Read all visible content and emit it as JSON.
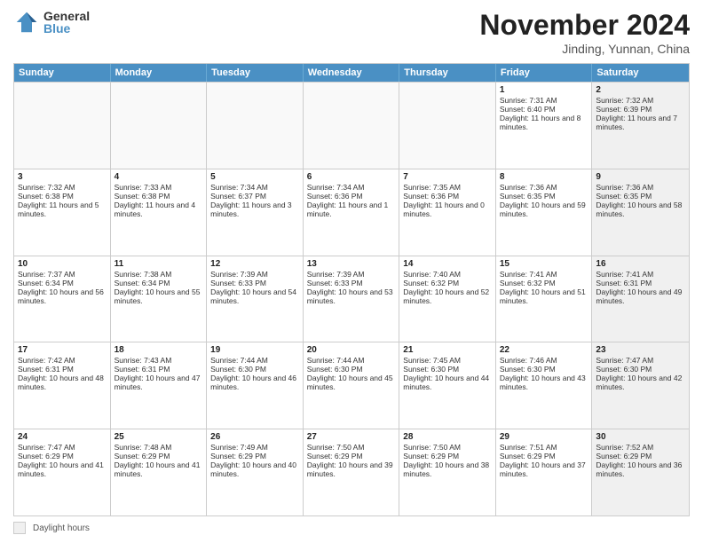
{
  "logo": {
    "general": "General",
    "blue": "Blue"
  },
  "title": {
    "month": "November 2024",
    "location": "Jinding, Yunnan, China"
  },
  "headers": [
    "Sunday",
    "Monday",
    "Tuesday",
    "Wednesday",
    "Thursday",
    "Friday",
    "Saturday"
  ],
  "weeks": [
    [
      {
        "day": "",
        "info": "",
        "shaded": false,
        "empty": true
      },
      {
        "day": "",
        "info": "",
        "shaded": false,
        "empty": true
      },
      {
        "day": "",
        "info": "",
        "shaded": false,
        "empty": true
      },
      {
        "day": "",
        "info": "",
        "shaded": false,
        "empty": true
      },
      {
        "day": "",
        "info": "",
        "shaded": false,
        "empty": true
      },
      {
        "day": "1",
        "info": "Sunrise: 7:31 AM\nSunset: 6:40 PM\nDaylight: 11 hours and 8 minutes.",
        "shaded": false,
        "empty": false
      },
      {
        "day": "2",
        "info": "Sunrise: 7:32 AM\nSunset: 6:39 PM\nDaylight: 11 hours and 7 minutes.",
        "shaded": true,
        "empty": false
      }
    ],
    [
      {
        "day": "3",
        "info": "Sunrise: 7:32 AM\nSunset: 6:38 PM\nDaylight: 11 hours and 5 minutes.",
        "shaded": false,
        "empty": false
      },
      {
        "day": "4",
        "info": "Sunrise: 7:33 AM\nSunset: 6:38 PM\nDaylight: 11 hours and 4 minutes.",
        "shaded": false,
        "empty": false
      },
      {
        "day": "5",
        "info": "Sunrise: 7:34 AM\nSunset: 6:37 PM\nDaylight: 11 hours and 3 minutes.",
        "shaded": false,
        "empty": false
      },
      {
        "day": "6",
        "info": "Sunrise: 7:34 AM\nSunset: 6:36 PM\nDaylight: 11 hours and 1 minute.",
        "shaded": false,
        "empty": false
      },
      {
        "day": "7",
        "info": "Sunrise: 7:35 AM\nSunset: 6:36 PM\nDaylight: 11 hours and 0 minutes.",
        "shaded": false,
        "empty": false
      },
      {
        "day": "8",
        "info": "Sunrise: 7:36 AM\nSunset: 6:35 PM\nDaylight: 10 hours and 59 minutes.",
        "shaded": false,
        "empty": false
      },
      {
        "day": "9",
        "info": "Sunrise: 7:36 AM\nSunset: 6:35 PM\nDaylight: 10 hours and 58 minutes.",
        "shaded": true,
        "empty": false
      }
    ],
    [
      {
        "day": "10",
        "info": "Sunrise: 7:37 AM\nSunset: 6:34 PM\nDaylight: 10 hours and 56 minutes.",
        "shaded": false,
        "empty": false
      },
      {
        "day": "11",
        "info": "Sunrise: 7:38 AM\nSunset: 6:34 PM\nDaylight: 10 hours and 55 minutes.",
        "shaded": false,
        "empty": false
      },
      {
        "day": "12",
        "info": "Sunrise: 7:39 AM\nSunset: 6:33 PM\nDaylight: 10 hours and 54 minutes.",
        "shaded": false,
        "empty": false
      },
      {
        "day": "13",
        "info": "Sunrise: 7:39 AM\nSunset: 6:33 PM\nDaylight: 10 hours and 53 minutes.",
        "shaded": false,
        "empty": false
      },
      {
        "day": "14",
        "info": "Sunrise: 7:40 AM\nSunset: 6:32 PM\nDaylight: 10 hours and 52 minutes.",
        "shaded": false,
        "empty": false
      },
      {
        "day": "15",
        "info": "Sunrise: 7:41 AM\nSunset: 6:32 PM\nDaylight: 10 hours and 51 minutes.",
        "shaded": false,
        "empty": false
      },
      {
        "day": "16",
        "info": "Sunrise: 7:41 AM\nSunset: 6:31 PM\nDaylight: 10 hours and 49 minutes.",
        "shaded": true,
        "empty": false
      }
    ],
    [
      {
        "day": "17",
        "info": "Sunrise: 7:42 AM\nSunset: 6:31 PM\nDaylight: 10 hours and 48 minutes.",
        "shaded": false,
        "empty": false
      },
      {
        "day": "18",
        "info": "Sunrise: 7:43 AM\nSunset: 6:31 PM\nDaylight: 10 hours and 47 minutes.",
        "shaded": false,
        "empty": false
      },
      {
        "day": "19",
        "info": "Sunrise: 7:44 AM\nSunset: 6:30 PM\nDaylight: 10 hours and 46 minutes.",
        "shaded": false,
        "empty": false
      },
      {
        "day": "20",
        "info": "Sunrise: 7:44 AM\nSunset: 6:30 PM\nDaylight: 10 hours and 45 minutes.",
        "shaded": false,
        "empty": false
      },
      {
        "day": "21",
        "info": "Sunrise: 7:45 AM\nSunset: 6:30 PM\nDaylight: 10 hours and 44 minutes.",
        "shaded": false,
        "empty": false
      },
      {
        "day": "22",
        "info": "Sunrise: 7:46 AM\nSunset: 6:30 PM\nDaylight: 10 hours and 43 minutes.",
        "shaded": false,
        "empty": false
      },
      {
        "day": "23",
        "info": "Sunrise: 7:47 AM\nSunset: 6:30 PM\nDaylight: 10 hours and 42 minutes.",
        "shaded": true,
        "empty": false
      }
    ],
    [
      {
        "day": "24",
        "info": "Sunrise: 7:47 AM\nSunset: 6:29 PM\nDaylight: 10 hours and 41 minutes.",
        "shaded": false,
        "empty": false
      },
      {
        "day": "25",
        "info": "Sunrise: 7:48 AM\nSunset: 6:29 PM\nDaylight: 10 hours and 41 minutes.",
        "shaded": false,
        "empty": false
      },
      {
        "day": "26",
        "info": "Sunrise: 7:49 AM\nSunset: 6:29 PM\nDaylight: 10 hours and 40 minutes.",
        "shaded": false,
        "empty": false
      },
      {
        "day": "27",
        "info": "Sunrise: 7:50 AM\nSunset: 6:29 PM\nDaylight: 10 hours and 39 minutes.",
        "shaded": false,
        "empty": false
      },
      {
        "day": "28",
        "info": "Sunrise: 7:50 AM\nSunset: 6:29 PM\nDaylight: 10 hours and 38 minutes.",
        "shaded": false,
        "empty": false
      },
      {
        "day": "29",
        "info": "Sunrise: 7:51 AM\nSunset: 6:29 PM\nDaylight: 10 hours and 37 minutes.",
        "shaded": false,
        "empty": false
      },
      {
        "day": "30",
        "info": "Sunrise: 7:52 AM\nSunset: 6:29 PM\nDaylight: 10 hours and 36 minutes.",
        "shaded": true,
        "empty": false
      }
    ]
  ],
  "legend": {
    "shaded_label": "Daylight hours"
  }
}
